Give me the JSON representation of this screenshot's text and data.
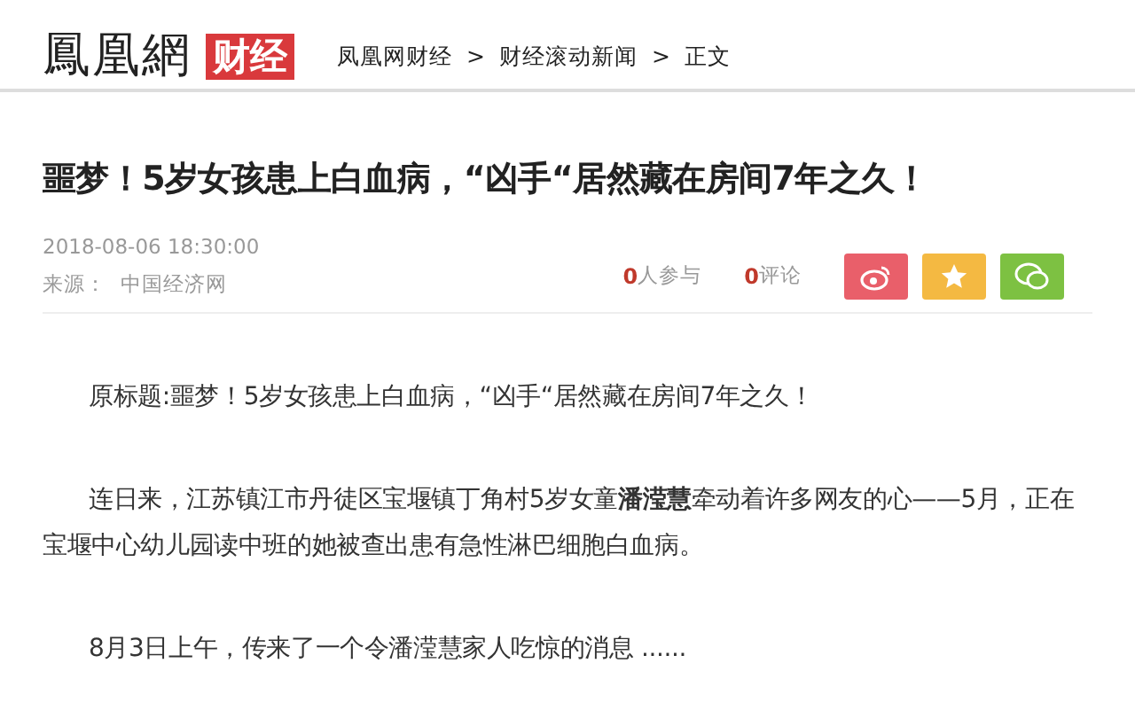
{
  "header": {
    "logo": "鳳凰網",
    "channel": "财经",
    "breadcrumb": [
      {
        "label": "凤凰网财经"
      },
      {
        "label": "财经滚动新闻"
      },
      {
        "label": "正文"
      }
    ],
    "separator": ">"
  },
  "article": {
    "title": "噩梦！5岁女孩患上白血病，“凶手“居然藏在房间7年之久！",
    "date": "2018-08-06 18:30:00",
    "source_label": "来源：",
    "source": "中国经济网",
    "stats": [
      {
        "count": "0",
        "label": "人参与"
      },
      {
        "count": "0",
        "label": "评论"
      }
    ],
    "share_buttons": [
      {
        "kind": "weibo",
        "color": "#e95f6a"
      },
      {
        "kind": "star",
        "color": "#f4b942"
      },
      {
        "kind": "wechat",
        "color": "#7dc142"
      }
    ],
    "paragraphs": [
      "原标题:噩梦！5岁女孩患上白血病，“凶手“居然藏在房间7年之久！",
      "连日来，江苏镇江市丹徒区宝堰镇丁角村5岁女童**潘滢慧**牵动着许多网友的心——5月，正在宝堰中心幼儿园读中班的她被查出患有急性淋巴细胞白血病。",
      "8月3日上午，传来了一个令潘滢慧家人吃惊的消息 ......"
    ]
  }
}
